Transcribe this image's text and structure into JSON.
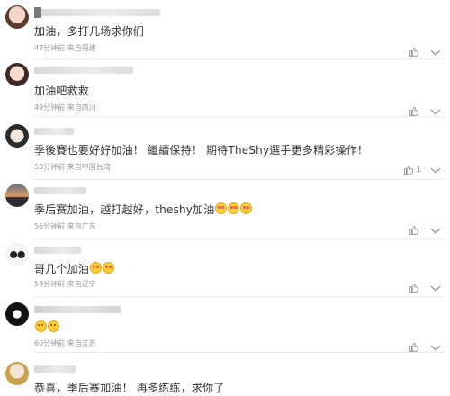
{
  "comments": [
    {
      "text": "加油，多打几场求你们",
      "time": "47分钟前",
      "from": "来自福建",
      "likes": "",
      "emojis": 0
    },
    {
      "text": "加油吧救救",
      "time": "49分钟前",
      "from": "来自四川",
      "likes": "",
      "emojis": 0
    },
    {
      "text": "季後賽也要好好加油！ 繼續保持！ 期待TheShy選手更多精彩操作！",
      "time": "53分钟前",
      "from": "来自中国台湾",
      "likes": "1",
      "emojis": 0
    },
    {
      "text": "季后赛加油，越打越好，theshy加油",
      "time": "56分钟前",
      "from": "来自广东",
      "likes": "",
      "emojis": 3
    },
    {
      "text": "哥几个加油",
      "time": "58分钟前",
      "from": "来自辽宁",
      "likes": "",
      "emojis": 2
    },
    {
      "text": "",
      "time": "60分钟前",
      "from": "来自江苏",
      "likes": "",
      "emojis": 2
    },
    {
      "text": "恭喜，季后赛加油！ 再多练练，求你了",
      "time": "",
      "from": "",
      "likes": "",
      "emojis": 0
    }
  ],
  "icons": {
    "like": "thumbs-up-icon",
    "more": "chevron-down-icon"
  },
  "colors": {
    "meta": "#9a9a9a",
    "text": "#333333",
    "separator": "#ececec"
  }
}
